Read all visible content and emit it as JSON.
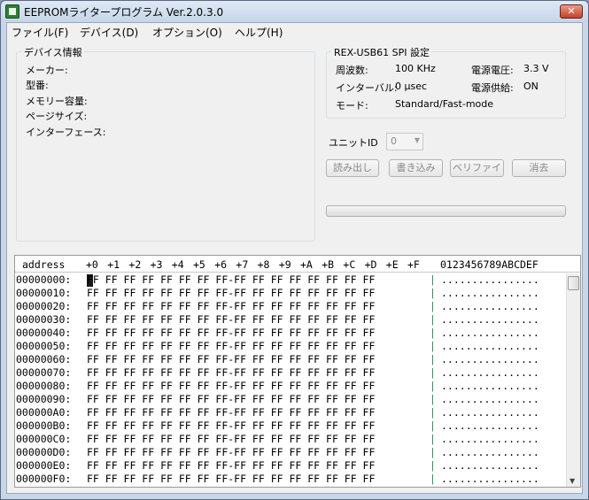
{
  "window": {
    "title": "EEPROMライタープログラム  Ver.2.0.3.0",
    "close_label": "✕"
  },
  "menu": [
    {
      "label": "ファイル(F)"
    },
    {
      "label": "デバイス(D)"
    },
    {
      "label": "オプション(O)"
    },
    {
      "label": "ヘルプ(H)"
    }
  ],
  "device_info": {
    "title": "デバイス情報",
    "maker_label": "メーカー:",
    "model_label": "型番:",
    "memory_label": "メモリー容量:",
    "page_label": "ページサイズ:",
    "interface_label": "インターフェース:"
  },
  "spi": {
    "title": "REX-USB61 SPI 設定",
    "freq_label": "周波数:",
    "freq_value": "100 KHz",
    "voltage_label": "電源電圧:",
    "voltage_value": "3.3 V",
    "interval_label": "インターバル:",
    "interval_value": "0 µsec",
    "supply_label": "電源供給:",
    "supply_value": "ON",
    "mode_label": "モード:",
    "mode_value": "Standard/Fast-mode"
  },
  "unit": {
    "label": "ユニットID",
    "value": "0"
  },
  "buttons": {
    "read": "読み出し",
    "write": "書き込み",
    "verify": "ベリファイ",
    "erase": "消去"
  },
  "hex": {
    "address_header": "address",
    "columns": [
      "+0",
      "+1",
      "+2",
      "+3",
      "+4",
      "+5",
      "+6",
      "+7",
      "+8",
      "+9",
      "+A",
      "+B",
      "+C",
      "+D",
      "+E",
      "+F"
    ],
    "ascii_header": "0123456789ABCDEF",
    "rows": [
      {
        "addr": "00000000:",
        "bytes": "FF FF FF FF FF FF FF FF-FF FF FF FF FF FF FF FF",
        "ascii": "................"
      },
      {
        "addr": "00000010:",
        "bytes": "FF FF FF FF FF FF FF FF-FF FF FF FF FF FF FF FF",
        "ascii": "................"
      },
      {
        "addr": "00000020:",
        "bytes": "FF FF FF FF FF FF FF FF-FF FF FF FF FF FF FF FF",
        "ascii": "................"
      },
      {
        "addr": "00000030:",
        "bytes": "FF FF FF FF FF FF FF FF-FF FF FF FF FF FF FF FF",
        "ascii": "................"
      },
      {
        "addr": "00000040:",
        "bytes": "FF FF FF FF FF FF FF FF-FF FF FF FF FF FF FF FF",
        "ascii": "................"
      },
      {
        "addr": "00000050:",
        "bytes": "FF FF FF FF FF FF FF FF-FF FF FF FF FF FF FF FF",
        "ascii": "................"
      },
      {
        "addr": "00000060:",
        "bytes": "FF FF FF FF FF FF FF FF-FF FF FF FF FF FF FF FF",
        "ascii": "................"
      },
      {
        "addr": "00000070:",
        "bytes": "FF FF FF FF FF FF FF FF-FF FF FF FF FF FF FF FF",
        "ascii": "................"
      },
      {
        "addr": "00000080:",
        "bytes": "FF FF FF FF FF FF FF FF-FF FF FF FF FF FF FF FF",
        "ascii": "................"
      },
      {
        "addr": "00000090:",
        "bytes": "FF FF FF FF FF FF FF FF-FF FF FF FF FF FF FF FF",
        "ascii": "................"
      },
      {
        "addr": "000000A0:",
        "bytes": "FF FF FF FF FF FF FF FF-FF FF FF FF FF FF FF FF",
        "ascii": "................"
      },
      {
        "addr": "000000B0:",
        "bytes": "FF FF FF FF FF FF FF FF-FF FF FF FF FF FF FF FF",
        "ascii": "................"
      },
      {
        "addr": "000000C0:",
        "bytes": "FF FF FF FF FF FF FF FF-FF FF FF FF FF FF FF FF",
        "ascii": "................"
      },
      {
        "addr": "000000D0:",
        "bytes": "FF FF FF FF FF FF FF FF-FF FF FF FF FF FF FF FF",
        "ascii": "................"
      },
      {
        "addr": "000000E0:",
        "bytes": "FF FF FF FF FF FF FF FF-FF FF FF FF FF FF FF FF",
        "ascii": "................"
      },
      {
        "addr": "000000F0:",
        "bytes": "FF FF FF FF FF FF FF FF-FF FF FF FF FF FF FF FF",
        "ascii": "................"
      }
    ]
  }
}
